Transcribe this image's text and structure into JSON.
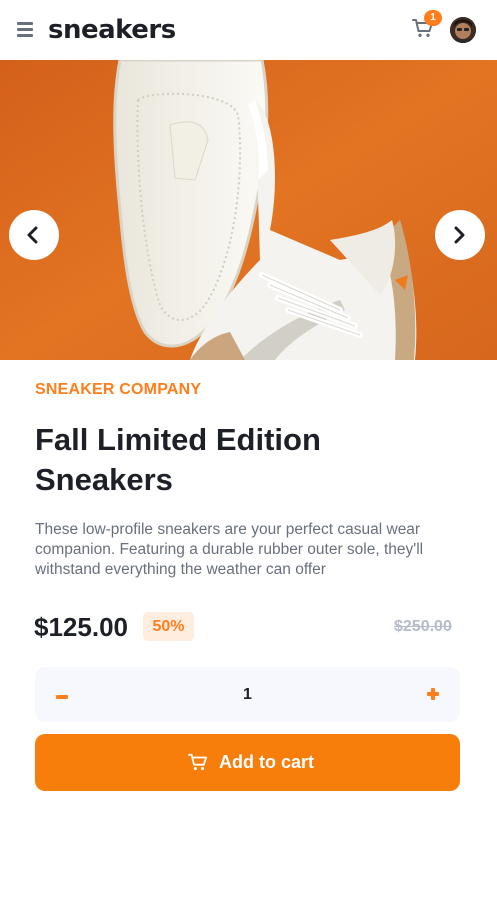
{
  "header": {
    "logo": "sneakers",
    "cart_count": "1",
    "icons": {
      "menu": "menu-icon",
      "cart": "cart-icon",
      "avatar": "avatar"
    }
  },
  "hero": {
    "icons": {
      "prev": "chevron-left-icon",
      "next": "chevron-right-icon"
    },
    "colors": {
      "background": "#e0731f"
    }
  },
  "product": {
    "company": "SNEAKER COMPANY",
    "title": "Fall Limited Edition Sneakers",
    "description": "These low-profile sneakers are your perfect casual wear companion. Featuring a durable rubber outer sole, they'll withstand everything the weather can offer",
    "price": "$125.00",
    "discount": "50%",
    "original_price": "$250.00"
  },
  "quantity": {
    "value": "1"
  },
  "cta": {
    "label": "Add to cart",
    "icon": "cart-icon"
  },
  "colors": {
    "accent": "#ff7e1b",
    "pale_accent": "#ffede0",
    "text_dark": "#1d2026",
    "text_muted": "#69707d"
  }
}
